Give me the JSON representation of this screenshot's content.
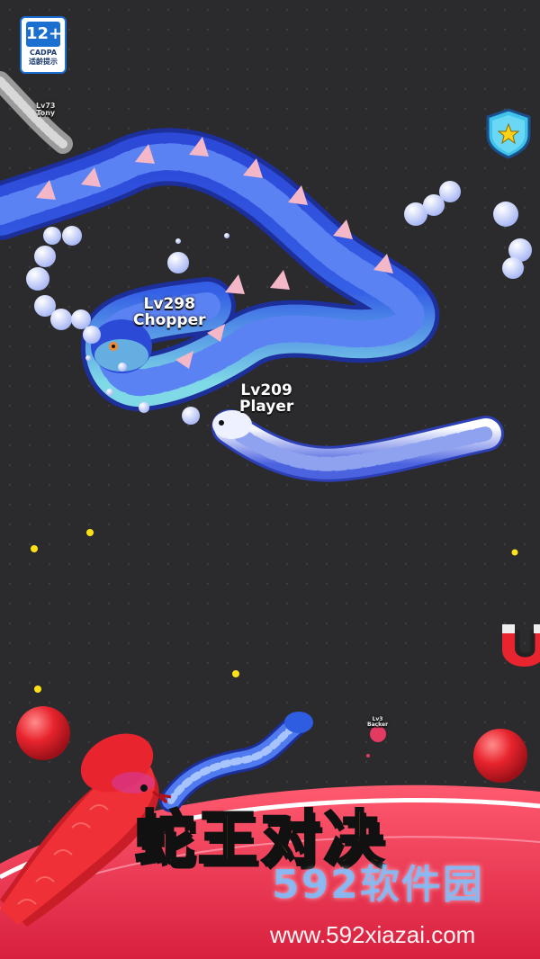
{
  "rating": {
    "age": "12+",
    "org": "CADPA",
    "note": "适龄提示"
  },
  "snakes": [
    {
      "id": "chopper",
      "level": "Lv298",
      "name": "Chopper"
    },
    {
      "id": "player",
      "level": "Lv209",
      "name": "Player"
    },
    {
      "id": "tony",
      "level": "Lv73",
      "name": "Tony"
    },
    {
      "id": "small",
      "level": "Lv3",
      "name": "Backer"
    }
  ],
  "powerups": {
    "shield": "shield-icon",
    "magnet": "magnet-icon"
  },
  "banner": {
    "title": "蛇王对决"
  },
  "watermark": {
    "brand": "592软件园",
    "url": "www.592xiazai.com"
  },
  "colors": {
    "background": "#2b2b2d",
    "blue_snake": "#2f5fe0",
    "red_snake": "#e9242e",
    "title": "#ffe11a",
    "banner": "#ef3b55"
  }
}
